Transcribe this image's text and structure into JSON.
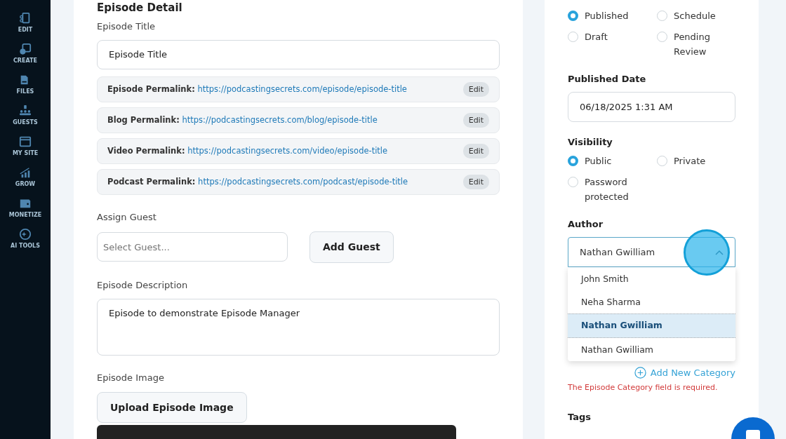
{
  "sidebar": {
    "items": [
      {
        "label": "EDIT",
        "kind": "edit"
      },
      {
        "label": "CREATE",
        "kind": "create"
      },
      {
        "label": "FILES",
        "kind": "files"
      },
      {
        "label": "GUESTS",
        "kind": "guests"
      },
      {
        "label": "MY SITE",
        "kind": "site"
      },
      {
        "label": "GROW",
        "kind": "grow"
      },
      {
        "label": "MONETIZE",
        "kind": "monetize"
      },
      {
        "label": "AI TOOLS",
        "kind": "ai"
      }
    ]
  },
  "episode": {
    "heading": "Episode Detail",
    "title_label": "Episode Title",
    "title_value": "Episode Title",
    "permalinks": [
      {
        "label": "Episode Permalink:",
        "url": "https://podcastingsecrets.com/episode/episode-title",
        "button": "Edit"
      },
      {
        "label": "Blog Permalink:",
        "url": "https://podcastingsecrets.com/blog/episode-title",
        "button": "Edit"
      },
      {
        "label": "Video Permalink:",
        "url": "https://podcastingsecrets.com/video/episode-title",
        "button": "Edit"
      },
      {
        "label": "Podcast Permalink:",
        "url": "https://podcastingsecrets.com/podcast/episode-title",
        "button": "Edit"
      }
    ],
    "guest_label": "Assign Guest",
    "guest_placeholder": "Select Guest...",
    "add_guest": "Add Guest",
    "description_label": "Episode Description",
    "description_value": "Episode to demonstrate Episode Manager",
    "image_label": "Episode Image",
    "upload_button": "Upload Episode Image"
  },
  "publish": {
    "status": [
      {
        "label": "Published",
        "selected": true
      },
      {
        "label": "Schedule",
        "selected": false
      },
      {
        "label": "Draft",
        "selected": false
      },
      {
        "label": "Pending Review",
        "selected": false
      }
    ],
    "date_label": "Published Date",
    "date_value": "06/18/2025 1:31 AM",
    "visibility_label": "Visibility",
    "visibility": [
      {
        "label": "Public",
        "selected": true
      },
      {
        "label": "Private",
        "selected": false
      },
      {
        "label": "Password protected",
        "selected": false
      }
    ],
    "author_label": "Author",
    "author_value": "Nathan Gwilliam",
    "author_expanded": true,
    "author_options": [
      {
        "label": "John Smith",
        "selected": false
      },
      {
        "label": "Neha Sharma",
        "selected": false
      },
      {
        "label": "Nathan Gwilliam",
        "selected": true
      },
      {
        "label": "Nathan Gwilliam",
        "selected": false
      }
    ],
    "add_category": "Add New Category",
    "error": "The Episode Category field is required.",
    "tags_label": "Tags"
  }
}
